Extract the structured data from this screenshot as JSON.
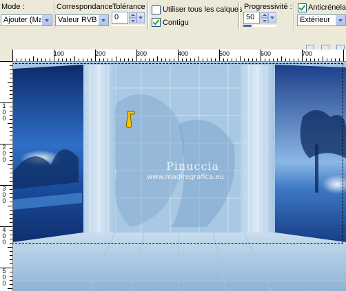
{
  "toolbar": {
    "mode": {
      "label": "Mode :",
      "value": "Ajouter (Maj)"
    },
    "match": {
      "label": "Correspondance :",
      "value": "Valeur RVB"
    },
    "tolerance": {
      "label": "Tolérance :",
      "value": "0"
    },
    "use_all_layers": {
      "label": "Utiliser tous les calques",
      "checked": false
    },
    "contiguous": {
      "label": "Contigu",
      "checked": true
    },
    "feather": {
      "label": "Progressivité :",
      "value": "50"
    },
    "antialias": {
      "label": "Anticrénelage",
      "checked": true,
      "value": "Extérieur"
    }
  },
  "ruler": {
    "horizontal": [
      "100",
      "200",
      "300",
      "400",
      "500",
      "600",
      "700"
    ],
    "vertical": [
      "1\n0\n0",
      "2\n0\n0",
      "3\n0\n0",
      "4\n0\n0",
      "5\n0\n0"
    ]
  },
  "canvas": {
    "watermark_name": "Pinuccia",
    "watermark_url": "www.madiregrafica.eu",
    "colors": {
      "sky": "#9fc0dc",
      "tile": "#b8d4ea",
      "deep": "#1b4fa0",
      "pillar": "#cfe2f2"
    }
  }
}
